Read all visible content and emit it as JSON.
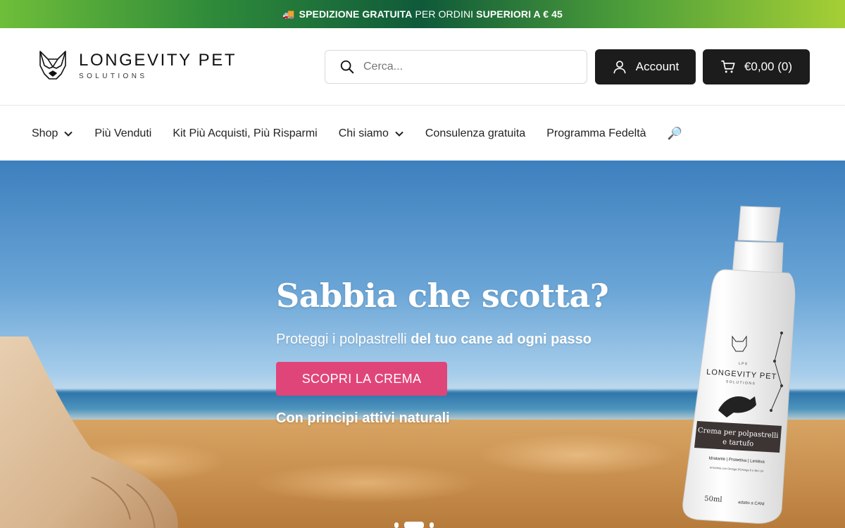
{
  "announcement": {
    "icon": "truck-icon",
    "strong_1": "SPEDIZIONE GRATUITA",
    "regular": "PER ORDINI",
    "strong_2": "SUPERIORI A € 45",
    "gradient_colors": [
      "#6fbe3a",
      "#0f5a3a",
      "#a6cf35"
    ]
  },
  "logo": {
    "main": "LONGEVITY PET",
    "sub": "SOLUTIONS"
  },
  "search": {
    "placeholder": "Cerca..."
  },
  "header_actions": {
    "account_label": "Account",
    "cart_label": "€0,00 (0)"
  },
  "nav": {
    "items": [
      {
        "label": "Shop",
        "has_dropdown": true
      },
      {
        "label": "Più Venduti",
        "has_dropdown": false
      },
      {
        "label": "Kit Più Acquisti, Più Risparmi",
        "has_dropdown": false
      },
      {
        "label": "Chi siamo",
        "has_dropdown": true
      },
      {
        "label": "Consulenza gratuita",
        "has_dropdown": false
      },
      {
        "label": "Programma Fedeltà",
        "has_dropdown": false
      }
    ],
    "search_emoji": "🔎"
  },
  "hero": {
    "title": "Sabbia che scotta?",
    "subtitle_regular": "Proteggi i polpastrelli",
    "subtitle_bold": "del tuo cane ad ogni passo",
    "cta": "SCOPRI LA CREMA",
    "note": "Con principi attivi naturali",
    "cta_color": "#e0457a",
    "product": {
      "brand_small": "L P S",
      "brand": "LONGEVITY PET",
      "brand_sub": "SOLUTIONS",
      "name_1": "Crema per polpastrelli",
      "name_2": "e tartufo",
      "claims": "Idratante | Protettiva | Lenitiva",
      "detail": "Arricchita con Omega 3/Omega 6 e filtri UV",
      "volume": "50ml",
      "target": "adatto a CANI"
    }
  },
  "colors": {
    "header_button": "#1c1c1c",
    "text": "#222222"
  }
}
